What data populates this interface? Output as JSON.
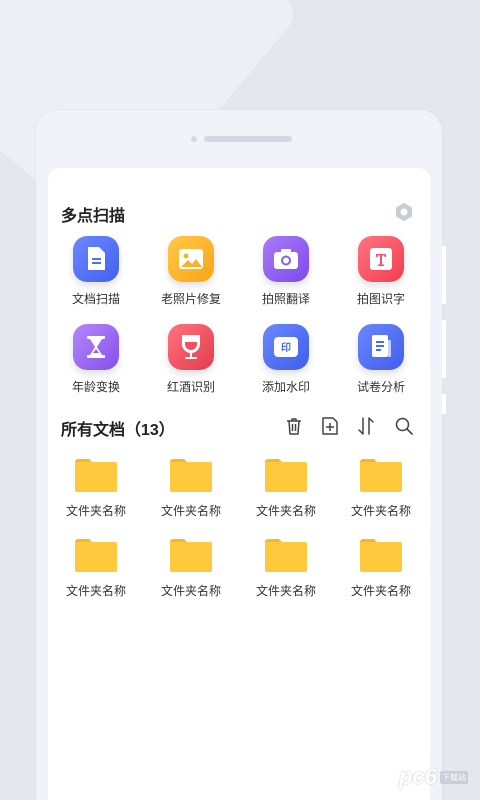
{
  "scan_section": {
    "title": "多点扫描",
    "tools": [
      {
        "label": "文档扫描",
        "color": "#4f6ff5",
        "icon": "document-icon"
      },
      {
        "label": "老照片修复",
        "color": "#fbb22a",
        "icon": "photo-icon"
      },
      {
        "label": "拍照翻译",
        "color": "#8d5cf0",
        "icon": "camera-icon"
      },
      {
        "label": "拍图识字",
        "color": "#f55361",
        "icon": "text-t-icon"
      },
      {
        "label": "年龄变换",
        "color": "#9a62ef",
        "icon": "hourglass-icon"
      },
      {
        "label": "红酒识别",
        "color": "#f2505f",
        "icon": "wine-glass-icon"
      },
      {
        "label": "添加水印",
        "color": "#4e6bf3",
        "icon": "stamp-icon"
      },
      {
        "label": "试卷分析",
        "color": "#4b6cf2",
        "icon": "exam-paper-icon"
      }
    ]
  },
  "documents": {
    "title": "所有文档（13）",
    "folders": [
      {
        "label": "文件夹名称"
      },
      {
        "label": "文件夹名称"
      },
      {
        "label": "文件夹名称"
      },
      {
        "label": "文件夹名称"
      },
      {
        "label": "文件夹名称"
      },
      {
        "label": "文件夹名称"
      },
      {
        "label": "文件夹名称"
      },
      {
        "label": "文件夹名称"
      }
    ]
  },
  "watermark": {
    "logo": "pc6",
    "text": "下载站"
  },
  "colors": {
    "folder": "#ffc93e",
    "folder_tab": "#f6b72a",
    "settings": "#c8ccd6"
  }
}
